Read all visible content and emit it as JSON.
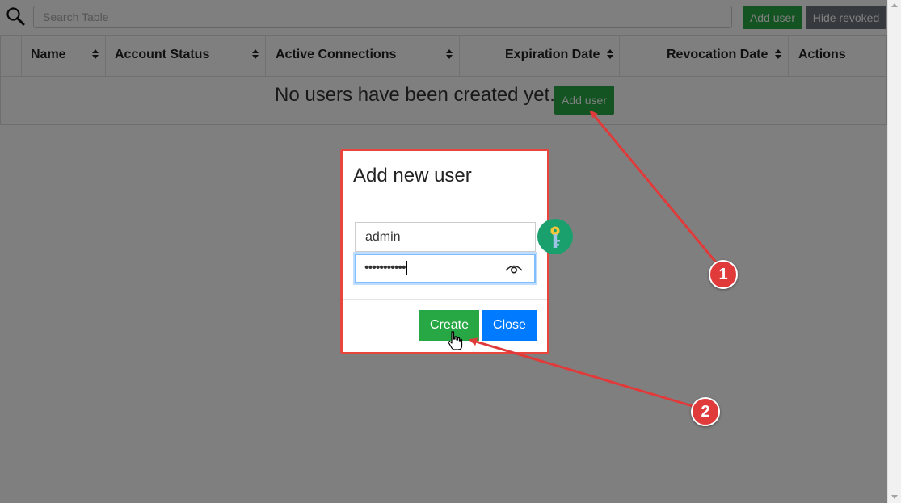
{
  "toolbar": {
    "search_placeholder": "Search Table",
    "add_user_label": "Add user",
    "hide_revoked_label": "Hide revoked"
  },
  "table": {
    "columns": [
      {
        "label": "Name",
        "sortable": true
      },
      {
        "label": "Account Status",
        "sortable": true
      },
      {
        "label": "Active Connections",
        "sortable": true
      },
      {
        "label": "Expiration Date",
        "sortable": true
      },
      {
        "label": "Revocation Date",
        "sortable": true
      },
      {
        "label": "Actions",
        "sortable": false
      }
    ],
    "empty_message": "No users have been created yet.",
    "empty_add_user_label": "Add user"
  },
  "modal": {
    "title": "Add new user",
    "username_value": "admin",
    "password_masked": "•••••••••••",
    "create_label": "Create",
    "close_label": "Close"
  },
  "annotations": {
    "step1": "1",
    "step2": "2"
  },
  "colors": {
    "success": "#28a745",
    "secondary": "#6c757d",
    "primary": "#007bff",
    "annotation": "#e03a3a",
    "key_badge": "#1aa06d"
  },
  "icons": {
    "search": "search-icon",
    "sort": "sort-icon",
    "eye": "eye-icon",
    "key": "key-icon",
    "cursor": "hand-cursor-icon"
  }
}
